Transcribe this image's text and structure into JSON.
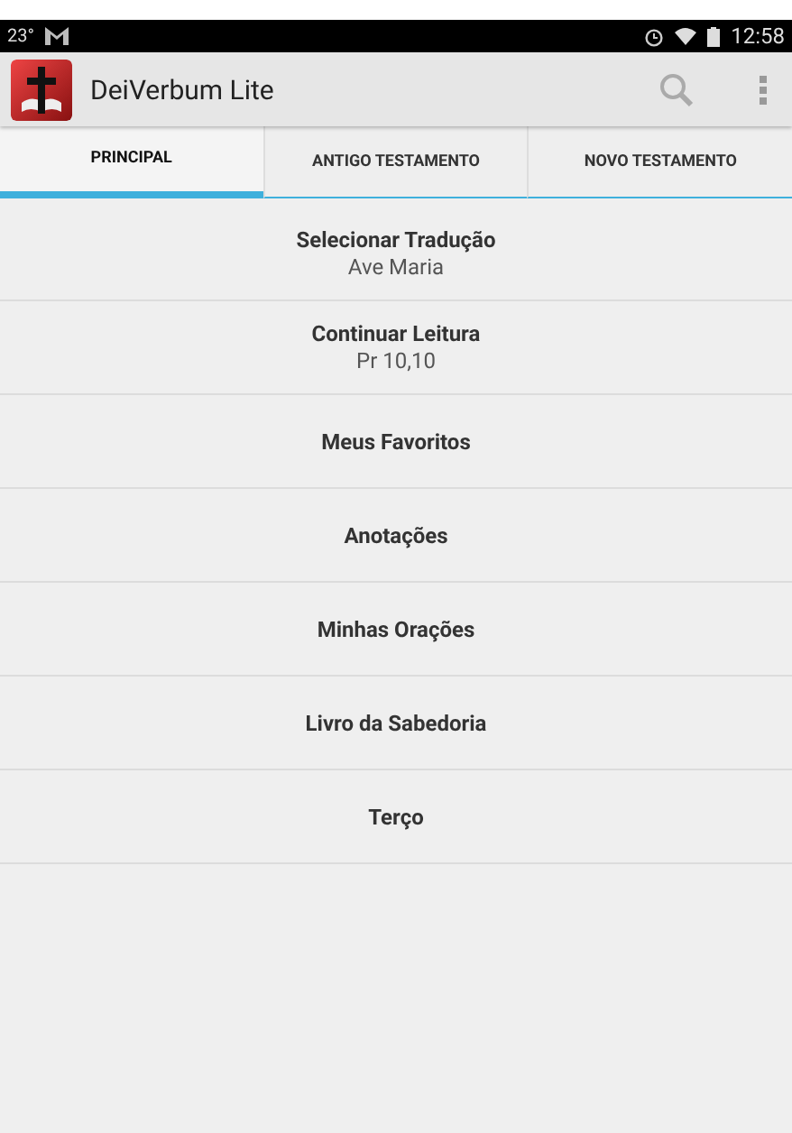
{
  "status_bar": {
    "temperature": "23°",
    "time": "12:58"
  },
  "app_bar": {
    "title": "DeiVerbum Lite"
  },
  "tabs": [
    {
      "label": "PRINCIPAL",
      "selected": true
    },
    {
      "label": "ANTIGO TESTAMENTO",
      "selected": false
    },
    {
      "label": "NOVO TESTAMENTO",
      "selected": false
    }
  ],
  "menu_items": [
    {
      "title": "Selecionar Tradução",
      "subtitle": "Ave Maria"
    },
    {
      "title": "Continuar Leitura",
      "subtitle": "Pr 10,10"
    },
    {
      "title": "Meus Favoritos"
    },
    {
      "title": "Anotações"
    },
    {
      "title": "Minhas Orações"
    },
    {
      "title": "Livro da Sabedoria"
    },
    {
      "title": "Terço"
    }
  ]
}
